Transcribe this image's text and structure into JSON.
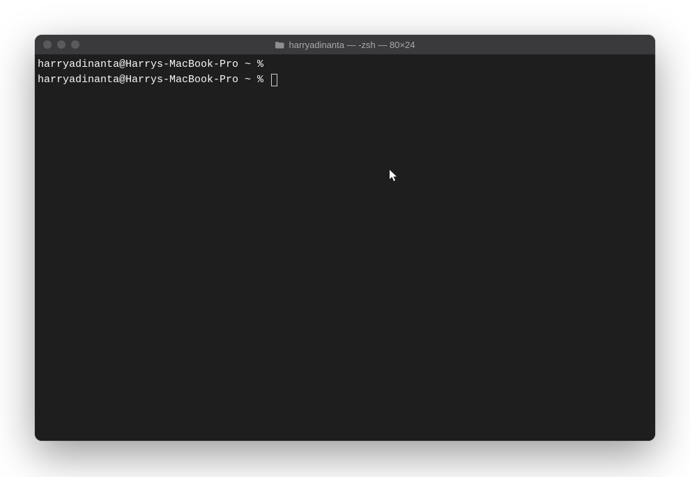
{
  "window": {
    "title": "harryadinanta — -zsh — 80×24",
    "icon": "folder-icon"
  },
  "terminal": {
    "lines": [
      {
        "prompt": "harryadinanta@Harrys-MacBook-Pro ~ % ",
        "hasCommand": false,
        "hasCursor": false
      },
      {
        "prompt": "harryadinanta@Harrys-MacBook-Pro ~ % ",
        "hasCommand": false,
        "hasCursor": true
      }
    ]
  },
  "colors": {
    "windowBg": "#1e1e1e",
    "titlebarBg": "#3a3a3c",
    "titleText": "#a8a8aa",
    "terminalText": "#f5f5f7",
    "trafficLight": "#5a5a5c"
  }
}
